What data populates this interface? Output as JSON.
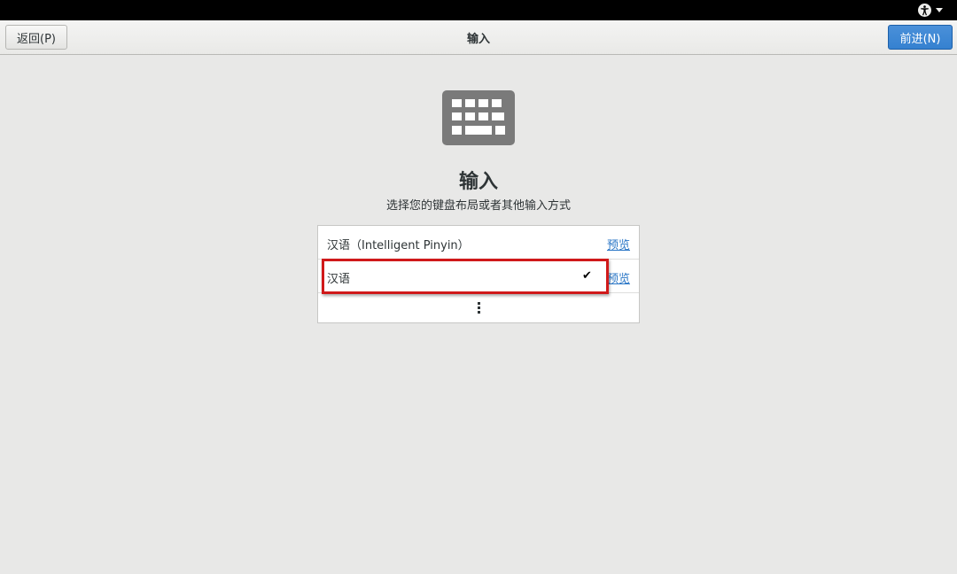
{
  "header": {
    "back_label": "返回(P)",
    "title": "输入",
    "next_label": "前进(N)"
  },
  "system": {
    "accessibility_icon": "accessibility-icon",
    "menu_icon": "caret-down-icon"
  },
  "page": {
    "icon": "keyboard-icon",
    "title": "输入",
    "subtitle": "选择您的键盘布局或者其他输入方式"
  },
  "input_sources": [
    {
      "label": "汉语（Intelligent Pinyin）",
      "preview_label": "预览",
      "selected": false
    },
    {
      "label": "汉语",
      "preview_label": "预览",
      "selected": true,
      "check_glyph": "✔"
    }
  ],
  "more_icon": "vertical-dots-icon",
  "colors": {
    "accent": "#3581d0",
    "link": "#2a76c6",
    "highlight": "#d0191a",
    "background": "#e8e8e7"
  }
}
